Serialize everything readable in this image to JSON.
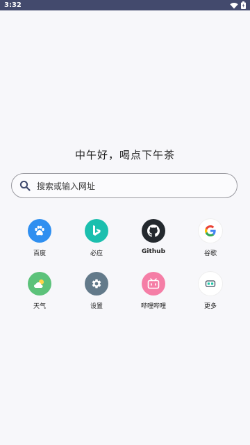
{
  "status_bar": {
    "time": "3:32",
    "wifi_icon": "wifi-icon",
    "battery_icon": "battery-icon"
  },
  "greeting": "中午好，喝点下午茶",
  "search": {
    "placeholder": "搜索或输入网址",
    "icon": "search-icon"
  },
  "shortcuts": [
    {
      "label": "百度",
      "icon": "baidu-paw-icon",
      "color": "#2f8ff0"
    },
    {
      "label": "必应",
      "icon": "bing-icon",
      "color": "#1bbfae"
    },
    {
      "label": "Github",
      "icon": "github-icon",
      "color": "#24292e"
    },
    {
      "label": "谷歌",
      "icon": "google-icon",
      "color": "#ffffff"
    },
    {
      "label": "天气",
      "icon": "weather-icon",
      "color": "#5cc27a"
    },
    {
      "label": "设置",
      "icon": "gear-icon",
      "color": "#637a8a"
    },
    {
      "label": "哔哩哔哩",
      "icon": "bilibili-tv-icon",
      "color": "#f57ea6"
    },
    {
      "label": "更多",
      "icon": "more-icon",
      "color": "#ffffff"
    }
  ]
}
